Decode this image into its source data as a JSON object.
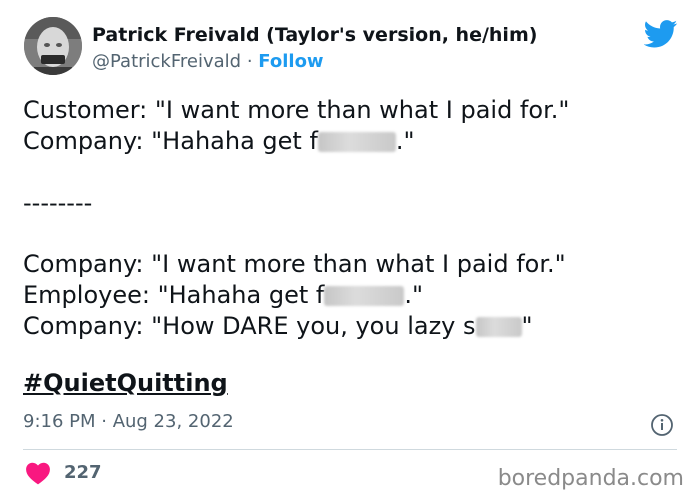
{
  "author": {
    "display_name": "Patrick Freivald (Taylor's version, he/him)",
    "handle": "@PatrickFreivald",
    "separator": "·",
    "follow_label": "Follow"
  },
  "tweet": {
    "lines": [
      {
        "before": "Customer: \"I want more than what I paid for.\"",
        "after": ""
      },
      {
        "before": "Company: \"Hahaha get f",
        "after": ".\""
      },
      {
        "before": "--------",
        "after": ""
      },
      {
        "before": "Company: \"I want more than what I paid for.\"",
        "after": ""
      },
      {
        "before": "Employee: \"Hahaha get f",
        "after": ".\""
      },
      {
        "before": "Company: \"How DARE you, you lazy s",
        "after": "\""
      }
    ],
    "hashtag": "#QuietQuitting",
    "timestamp": "9:16 PM · Aug 23, 2022",
    "like_count": "227"
  },
  "colors": {
    "brand_blue": "#1d9bf0",
    "like_red": "#f91880",
    "text": "#0f1419",
    "muted": "#536471"
  },
  "icons": {
    "brand": "twitter-bird-icon",
    "info": "info-icon",
    "like": "heart-icon"
  },
  "watermark": "boredpanda.com"
}
